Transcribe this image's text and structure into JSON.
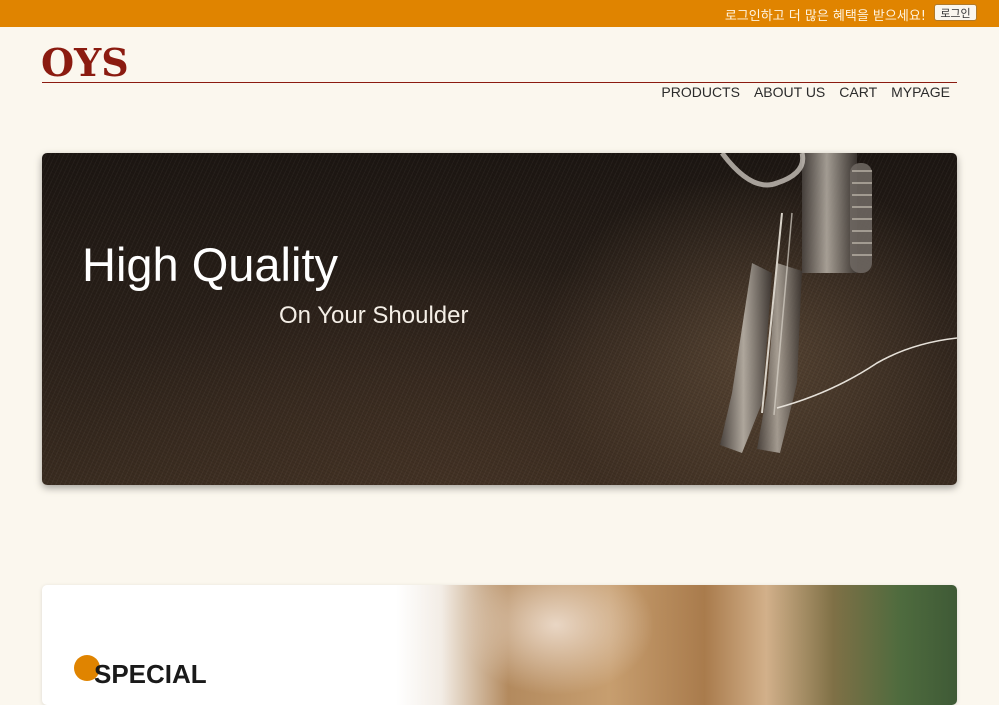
{
  "topbar": {
    "message": "로그인하고 더 많은 혜택을 받으세요!",
    "login_button": "로그인"
  },
  "brand": {
    "logo": "OYS"
  },
  "nav": {
    "items": [
      "PRODUCTS",
      "ABOUT US",
      "CART",
      "MYPAGE"
    ]
  },
  "hero": {
    "title": "High Quality",
    "subtitle": "On Your Shoulder"
  },
  "section": {
    "title": "SPECIAL"
  },
  "colors": {
    "accent": "#e08400",
    "brand": "#8b1b10",
    "background": "#fbf7ee"
  }
}
